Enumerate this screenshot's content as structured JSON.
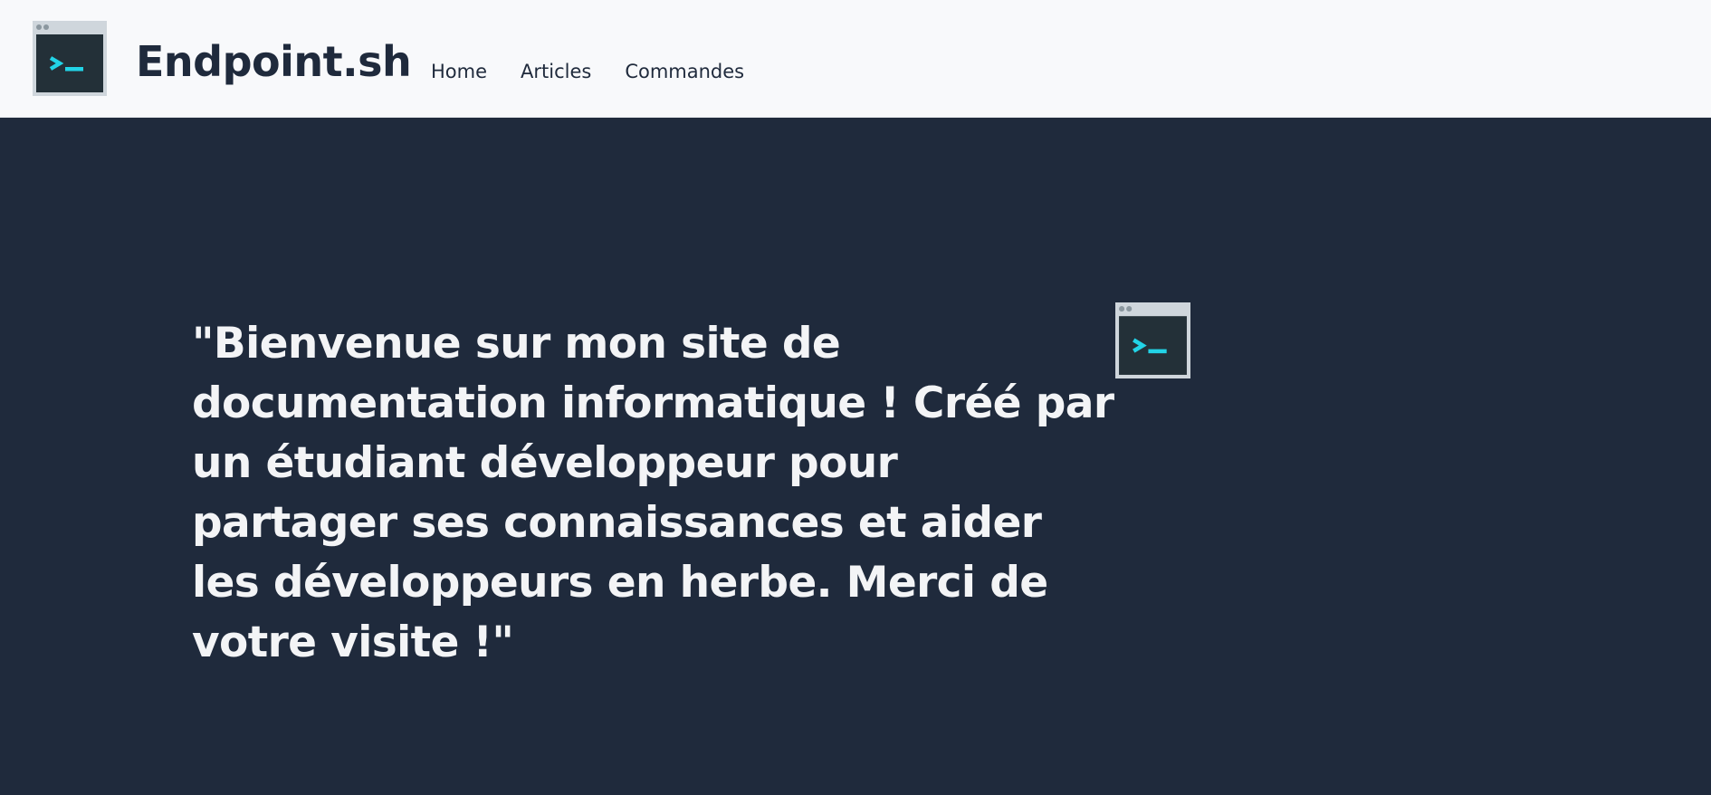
{
  "header": {
    "brand": "Endpoint.sh",
    "logo_icon": "terminal-icon",
    "nav": [
      {
        "label": "Home"
      },
      {
        "label": "Articles"
      },
      {
        "label": "Commandes"
      }
    ]
  },
  "hero": {
    "quote": "\"Bienvenue sur mon site de documentation informatique ! Créé par un étudiant développeur pour partager ses connaissances et aider les développeurs en herbe. Merci de votre visite !\"",
    "icon": "terminal-icon"
  },
  "colors": {
    "navbar_bg": "#f8f9fb",
    "hero_bg": "#1f2a3c",
    "text_dark": "#1f2a3c",
    "text_light": "#f3f4f6",
    "terminal_prompt": "#22d3e6"
  }
}
